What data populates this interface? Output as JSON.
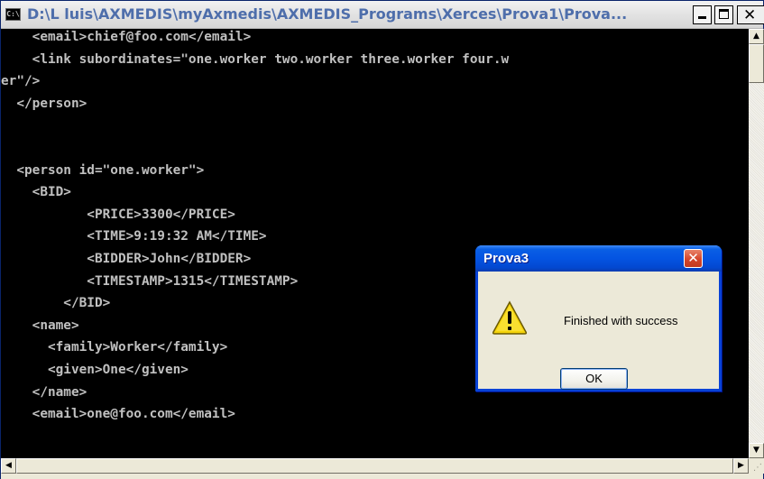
{
  "window": {
    "title": "D:\\L luis\\AXMEDIS\\myAxmedis\\AXMEDIS_Programs\\Xerces\\Prova1\\Prova...",
    "app_icon_text": "C:\\",
    "minimize_glyph": "",
    "close_glyph": "✕"
  },
  "console": {
    "lines": [
      "    <email>chief@foo.com</email>",
      "    <link subordinates=\"one.worker two.worker three.worker four.w",
      "er\"/>",
      "  </person>",
      "",
      "",
      "  <person id=\"one.worker\">",
      "    <BID>",
      "           <PRICE>3300</PRICE>",
      "           <TIME>9:19:32 AM</TIME>",
      "           <BIDDER>John</BIDDER>",
      "           <TIMESTAMP>1315</TIMESTAMP>",
      "        </BID>",
      "    <name>",
      "      <family>Worker</family>",
      "      <given>One</given>",
      "    </name>",
      "    <email>one@foo.com</email>"
    ]
  },
  "scrollbars": {
    "up_arrow": "▲",
    "down_arrow": "▼",
    "left_arrow": "◀",
    "right_arrow": "▶",
    "grip": "⋰"
  },
  "dialog": {
    "title": "Prova3",
    "close_glyph": "✕",
    "message": "Finished with success",
    "ok_label": "OK",
    "icon": "warning-icon"
  },
  "colors": {
    "console_bg": "#000000",
    "console_text": "#c0c0c0",
    "dialog_title_blue": "#0454e2",
    "close_red": "#d5452b",
    "warning_yellow": "#f5d40b"
  }
}
